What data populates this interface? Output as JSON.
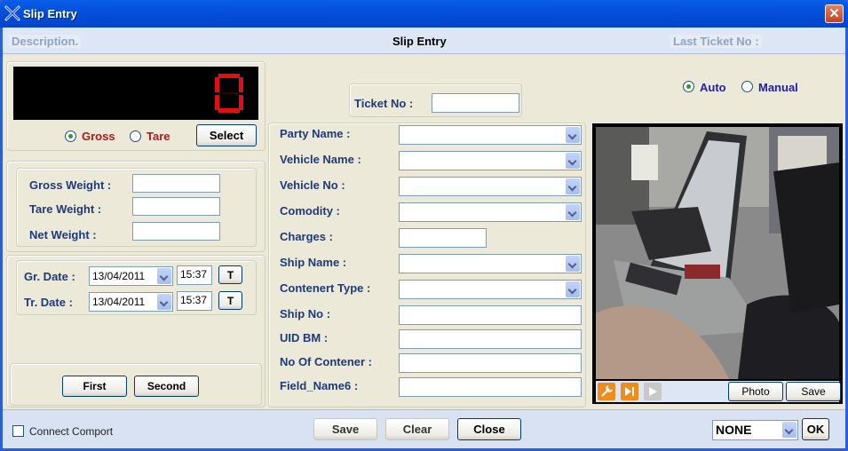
{
  "window": {
    "title": "Slip Entry",
    "close_glyph": "✕"
  },
  "header": {
    "description": "Description.",
    "title": "Slip Entry",
    "last_ticket": "Last Ticket No :"
  },
  "display": {
    "value": "0"
  },
  "weigh_mode": {
    "gross": "Gross",
    "tare": "Tare",
    "selected": "gross",
    "select_button": "Select"
  },
  "weights": {
    "gross_label": "Gross Weight :",
    "tare_label": "Tare Weight :",
    "net_label": "Net Weight :",
    "gross": "",
    "tare": "",
    "net": ""
  },
  "dates": {
    "gr_label": "Gr. Date :",
    "gr_date": "13/04/2011",
    "gr_time": "15:37",
    "tr_label": "Tr. Date :",
    "tr_date": "13/04/2011",
    "tr_time": "15:37",
    "t_button": "T"
  },
  "weigh_buttons": {
    "first": "First",
    "second": "Second"
  },
  "ticket": {
    "label": "Ticket No :",
    "value": ""
  },
  "entry_mode": {
    "auto": "Auto",
    "manual": "Manual",
    "selected": "auto"
  },
  "fields": {
    "party_name": "Party Name :",
    "vehicle_name": "Vehicle Name :",
    "vehicle_no": "Vehicle No :",
    "comodity": "Comodity :",
    "charges": "Charges :",
    "ship_name": "Ship Name :",
    "contenert_type": "Contenert Type :",
    "ship_no": "Ship No :",
    "uid_bm": "UID BM :",
    "no_of_contener": "No Of Contener :",
    "field_name6": "Field_Name6 :"
  },
  "camera": {
    "photo_button": "Photo",
    "save_button": "Save"
  },
  "footer": {
    "connect_comport": "Connect Comport",
    "save": "Save",
    "clear": "Clear",
    "close": "Close",
    "port_value": "NONE",
    "ok": "OK"
  },
  "colors": {
    "title_blue": "#0450dc",
    "label_blue": "#1e3a78",
    "label_red": "#b01818",
    "lcd_red": "#e01010",
    "dialog_bg": "#ece9d8"
  }
}
